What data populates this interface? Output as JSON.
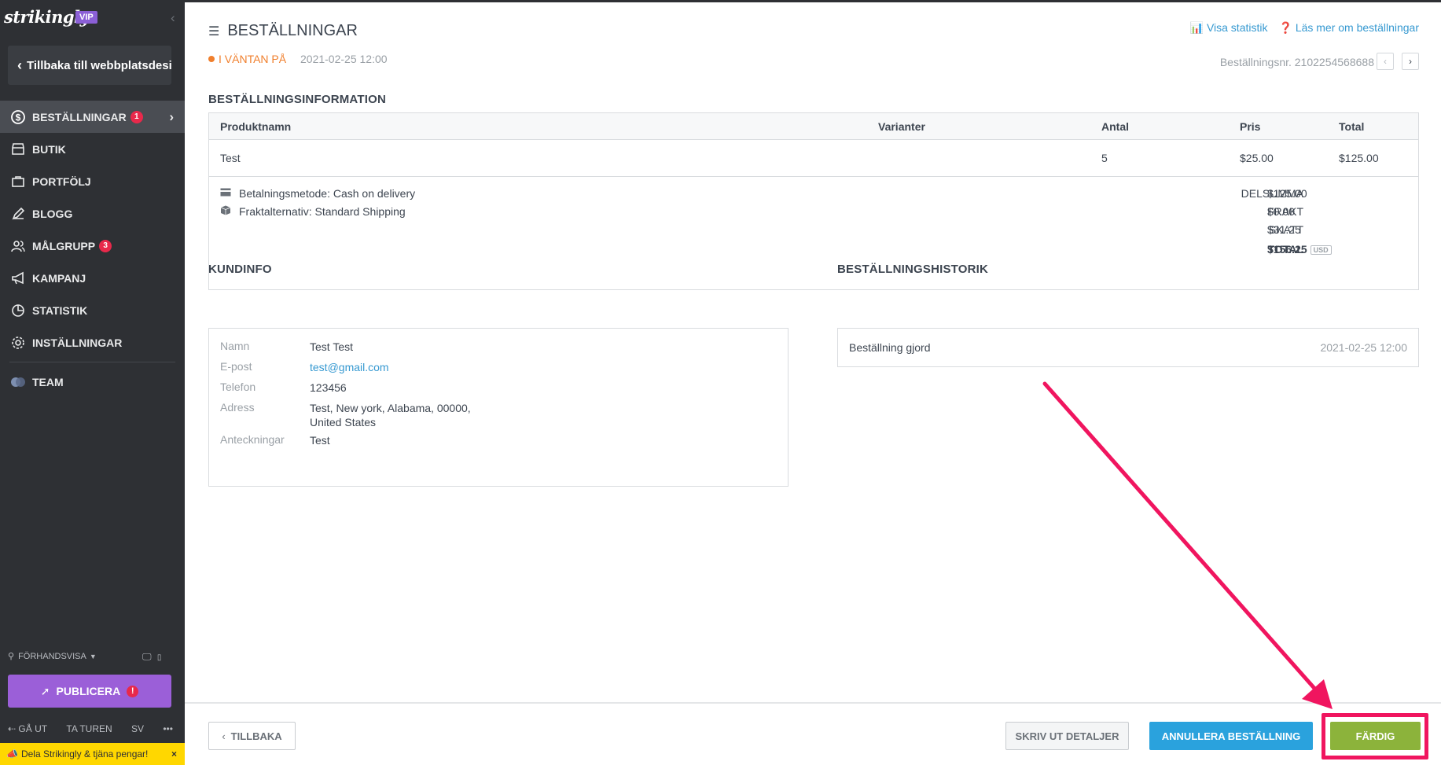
{
  "sidebar": {
    "logo": "strikingly",
    "vip": "VIP",
    "back_label": "Tillbaka till webbplatsdesign",
    "items": [
      {
        "label": "BESTÄLLNINGAR",
        "badge": "1"
      },
      {
        "label": "BUTIK"
      },
      {
        "label": "PORTFÖLJ"
      },
      {
        "label": "BLOGG"
      },
      {
        "label": "MÅLGRUPP",
        "badge": "3"
      },
      {
        "label": "KAMPANJ"
      },
      {
        "label": "STATISTIK"
      },
      {
        "label": "INSTÄLLNINGAR"
      },
      {
        "label": "TEAM"
      }
    ],
    "preview_label": "FÖRHANDSVISA",
    "publish_label": "PUBLICERA",
    "publish_warn": "!",
    "exit_label": "GÅ UT",
    "tour_label": "TA TUREN",
    "lang_label": "SV",
    "more_label": "•••",
    "share_text": "Dela Strikingly & tjäna pengar!",
    "share_close": "×"
  },
  "header": {
    "title": "BESTÄLLNINGAR",
    "stats_link": "Visa statistik",
    "help_link": "Läs mer om beställningar",
    "status": "I VÄNTAN PÅ",
    "date": "2021-02-25 12:00",
    "order_nr": "Beställningsnr. 2102254568688",
    "status_color": "#f07f2d"
  },
  "order": {
    "section_title": "BESTÄLLNINGSINFORMATION",
    "columns": [
      "Produktnamn",
      "Varianter",
      "Antal",
      "Pris",
      "Total"
    ],
    "rows": [
      {
        "name": "Test",
        "variants": "",
        "qty": "5",
        "price": "$25.00",
        "total": "$125.00"
      }
    ],
    "payment_method": "Betalningsmetode: Cash on delivery",
    "shipping_method": "Fraktalternativ: Standard Shipping",
    "totals": [
      {
        "label": "DELSUMMA",
        "value": "$125.00"
      },
      {
        "label": "FRAKT",
        "value": "$0.00"
      },
      {
        "label": "SKATT",
        "value": "$31.25"
      },
      {
        "label": "TOTAL",
        "value": "$156.25"
      }
    ],
    "currency": "USD"
  },
  "customer": {
    "section_title": "KUNDINFO",
    "fields": [
      {
        "key": "Namn",
        "value": "Test Test"
      },
      {
        "key": "E-post",
        "value": "test@gmail.com"
      },
      {
        "key": "Telefon",
        "value": "123456"
      },
      {
        "key": "Adress",
        "value": "Test, New york, Alabama, 00000,",
        "value2": "United States"
      },
      {
        "key": "Anteckningar",
        "value": "Test"
      }
    ]
  },
  "history": {
    "section_title": "BESTÄLLNINGSHISTORIK",
    "entries": [
      {
        "event": "Beställning gjord",
        "date": "2021-02-25 12:00"
      }
    ]
  },
  "footer": {
    "back_label": "TILLBAKA",
    "print_label": "SKRIV UT DETALJER",
    "cancel_label": "ANNULLERA BESTÄLLNING",
    "done_label": "FÄRDIG"
  },
  "colors": {
    "sidebar_bg": "#2e3034",
    "accent_purple": "#9b5fd8",
    "link_blue": "#3699d1",
    "cancel_blue": "#2aa2dd",
    "done_green": "#8cb33b",
    "highlight_pink": "#f0155f"
  }
}
